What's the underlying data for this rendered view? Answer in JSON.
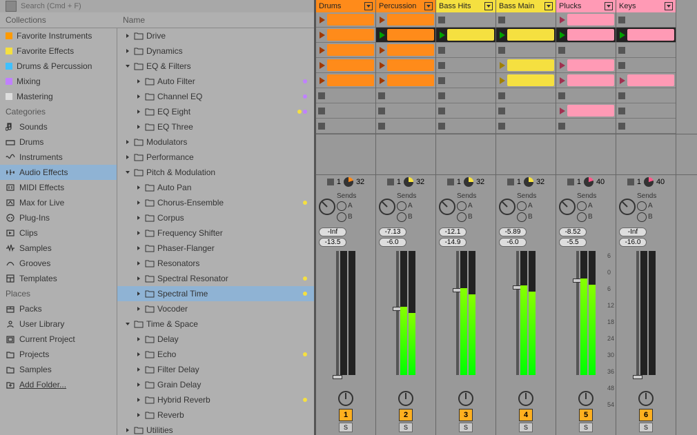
{
  "search": {
    "placeholder": "Search (Cmd + F)"
  },
  "browser": {
    "collections_label": "Collections",
    "name_label": "Name",
    "collections": [
      {
        "label": "Favorite Instruments",
        "color": "#ff9a00"
      },
      {
        "label": "Favorite Effects",
        "color": "#f5e040"
      },
      {
        "label": "Drums & Percussion",
        "color": "#40c0ff"
      },
      {
        "label": "Mixing",
        "color": "#c080ff"
      },
      {
        "label": "Mastering",
        "color": "#ddd"
      }
    ],
    "categories_label": "Categories",
    "categories": [
      {
        "label": "Sounds",
        "icon": "note"
      },
      {
        "label": "Drums",
        "icon": "drums"
      },
      {
        "label": "Instruments",
        "icon": "wave"
      },
      {
        "label": "Audio Effects",
        "icon": "fx",
        "selected": true
      },
      {
        "label": "MIDI Effects",
        "icon": "midifx"
      },
      {
        "label": "Max for Live",
        "icon": "max"
      },
      {
        "label": "Plug-Ins",
        "icon": "plug"
      },
      {
        "label": "Clips",
        "icon": "clip"
      },
      {
        "label": "Samples",
        "icon": "sample"
      },
      {
        "label": "Grooves",
        "icon": "groove"
      },
      {
        "label": "Templates",
        "icon": "template"
      }
    ],
    "places_label": "Places",
    "places": [
      {
        "label": "Packs",
        "icon": "pack"
      },
      {
        "label": "User Library",
        "icon": "user"
      },
      {
        "label": "Current Project",
        "icon": "project"
      },
      {
        "label": "Projects",
        "icon": "folder"
      },
      {
        "label": "Samples",
        "icon": "folder"
      },
      {
        "label": "Add Folder...",
        "icon": "add",
        "underline": true
      }
    ],
    "tree": [
      {
        "label": "Drive",
        "depth": 0,
        "expanded": false
      },
      {
        "label": "Dynamics",
        "depth": 0,
        "expanded": false
      },
      {
        "label": "EQ & Filters",
        "depth": 0,
        "expanded": true
      },
      {
        "label": "Auto Filter",
        "depth": 1,
        "dots": [
          "#c080ff"
        ]
      },
      {
        "label": "Channel EQ",
        "depth": 1,
        "dots": [
          "#c080ff"
        ]
      },
      {
        "label": "EQ Eight",
        "depth": 1,
        "dots": [
          "#f5e040",
          "#c080ff"
        ]
      },
      {
        "label": "EQ Three",
        "depth": 1
      },
      {
        "label": "Modulators",
        "depth": 0,
        "expanded": false
      },
      {
        "label": "Performance",
        "depth": 0,
        "expanded": false
      },
      {
        "label": "Pitch & Modulation",
        "depth": 0,
        "expanded": true
      },
      {
        "label": "Auto Pan",
        "depth": 1
      },
      {
        "label": "Chorus-Ensemble",
        "depth": 1,
        "dots": [
          "#f5e040"
        ]
      },
      {
        "label": "Corpus",
        "depth": 1
      },
      {
        "label": "Frequency Shifter",
        "depth": 1
      },
      {
        "label": "Phaser-Flanger",
        "depth": 1
      },
      {
        "label": "Resonators",
        "depth": 1
      },
      {
        "label": "Spectral Resonator",
        "depth": 1,
        "dots": [
          "#f5e040"
        ]
      },
      {
        "label": "Spectral Time",
        "depth": 1,
        "selected": true,
        "dots": [
          "#f5e040"
        ]
      },
      {
        "label": "Vocoder",
        "depth": 1
      },
      {
        "label": "Time & Space",
        "depth": 0,
        "expanded": true
      },
      {
        "label": "Delay",
        "depth": 1
      },
      {
        "label": "Echo",
        "depth": 1,
        "dots": [
          "#f5e040"
        ]
      },
      {
        "label": "Filter Delay",
        "depth": 1
      },
      {
        "label": "Grain Delay",
        "depth": 1
      },
      {
        "label": "Hybrid Reverb",
        "depth": 1,
        "dots": [
          "#f5e040"
        ]
      },
      {
        "label": "Reverb",
        "depth": 1
      },
      {
        "label": "Utilities",
        "depth": 0,
        "expanded": false
      }
    ]
  },
  "tracks": [
    {
      "name": "Drums",
      "color": "#ff8b1a",
      "num": "1",
      "vol1": "-Inf",
      "vol2": "-13.5",
      "meter": 0,
      "statusNum": "1",
      "statusTotal": "32",
      "statusColor": "#ff8b1a",
      "statusPct": "20%"
    },
    {
      "name": "Percussion",
      "color": "#ff8b1a",
      "num": "2",
      "vol1": "-7.13",
      "vol2": "-6.0",
      "meter": 55,
      "statusNum": "1",
      "statusTotal": "32",
      "statusColor": "#f5e040",
      "statusPct": "25%"
    },
    {
      "name": "Bass Hits",
      "color": "#f5e040",
      "num": "3",
      "vol1": "-12.1",
      "vol2": "-14.9",
      "meter": 70,
      "statusNum": "1",
      "statusTotal": "32",
      "statusColor": "#f5e040",
      "statusPct": "25%"
    },
    {
      "name": "Bass Main",
      "color": "#f5e040",
      "num": "4",
      "vol1": "-5.89",
      "vol2": "-6.0",
      "meter": 72,
      "statusNum": "1",
      "statusTotal": "32",
      "statusColor": "#f5e040",
      "statusPct": "25%"
    },
    {
      "name": "Plucks",
      "color": "#ff9ab5",
      "num": "5",
      "vol1": "-8.52",
      "vol2": "-5.5",
      "meter": 78,
      "statusNum": "1",
      "statusTotal": "40",
      "statusColor": "#ff5a8a",
      "statusPct": "20%"
    },
    {
      "name": "Keys",
      "color": "#ff9ab5",
      "num": "6",
      "vol1": "-Inf",
      "vol2": "-16.0",
      "meter": 0,
      "statusNum": "1",
      "statusTotal": "40",
      "statusColor": "#ff5a8a",
      "statusPct": "20%"
    }
  ],
  "clip_rows": [
    [
      {
        "c": "#ff8b1a",
        "p": "#a03800"
      },
      {
        "c": "#ff8b1a",
        "p": "#a03800"
      },
      null,
      null,
      {
        "c": "#ff9ab5",
        "p": "#a03050"
      },
      null
    ],
    [
      {
        "c": "#ff8b1a",
        "p": "#a03800"
      },
      {
        "c": "#ff8b1a",
        "p": "#00a000",
        "playing": true
      },
      {
        "c": "#f5e040",
        "p": "#00a000",
        "playing": true
      },
      {
        "c": "#f5e040",
        "p": "#00a000",
        "playing": true
      },
      {
        "c": "#ff9ab5",
        "p": "#00a000",
        "playing": true
      },
      {
        "c": "#ff9ab5",
        "p": "#00a000",
        "playing": true
      }
    ],
    [
      {
        "c": "#ff8b1a",
        "p": "#a03800"
      },
      {
        "c": "#ff8b1a",
        "p": "#a03800"
      },
      null,
      null,
      null,
      null
    ],
    [
      {
        "c": "#ff8b1a",
        "p": "#a03800"
      },
      {
        "c": "#ff8b1a",
        "p": "#a03800"
      },
      null,
      {
        "c": "#f5e040",
        "p": "#a08000"
      },
      {
        "c": "#ff9ab5",
        "p": "#a03050"
      },
      null
    ],
    [
      {
        "c": "#ff8b1a",
        "p": "#a03800"
      },
      {
        "c": "#ff8b1a",
        "p": "#a03800"
      },
      null,
      {
        "c": "#f5e040",
        "p": "#a08000"
      },
      {
        "c": "#ff9ab5",
        "p": "#a03050"
      },
      {
        "c": "#ff9ab5",
        "p": "#a03050"
      }
    ],
    [
      null,
      null,
      null,
      null,
      null,
      null
    ],
    [
      null,
      null,
      null,
      null,
      {
        "c": "#ff9ab5",
        "p": "#a03050"
      },
      null
    ],
    [
      null,
      null,
      null,
      null,
      null,
      null
    ]
  ],
  "sends_label": "Sends",
  "sends_a": "A",
  "sends_b": "B",
  "solo_label": "S",
  "db_scale": [
    "6",
    "0",
    "6",
    "12",
    "18",
    "24",
    "30",
    "36",
    "48",
    "54"
  ]
}
